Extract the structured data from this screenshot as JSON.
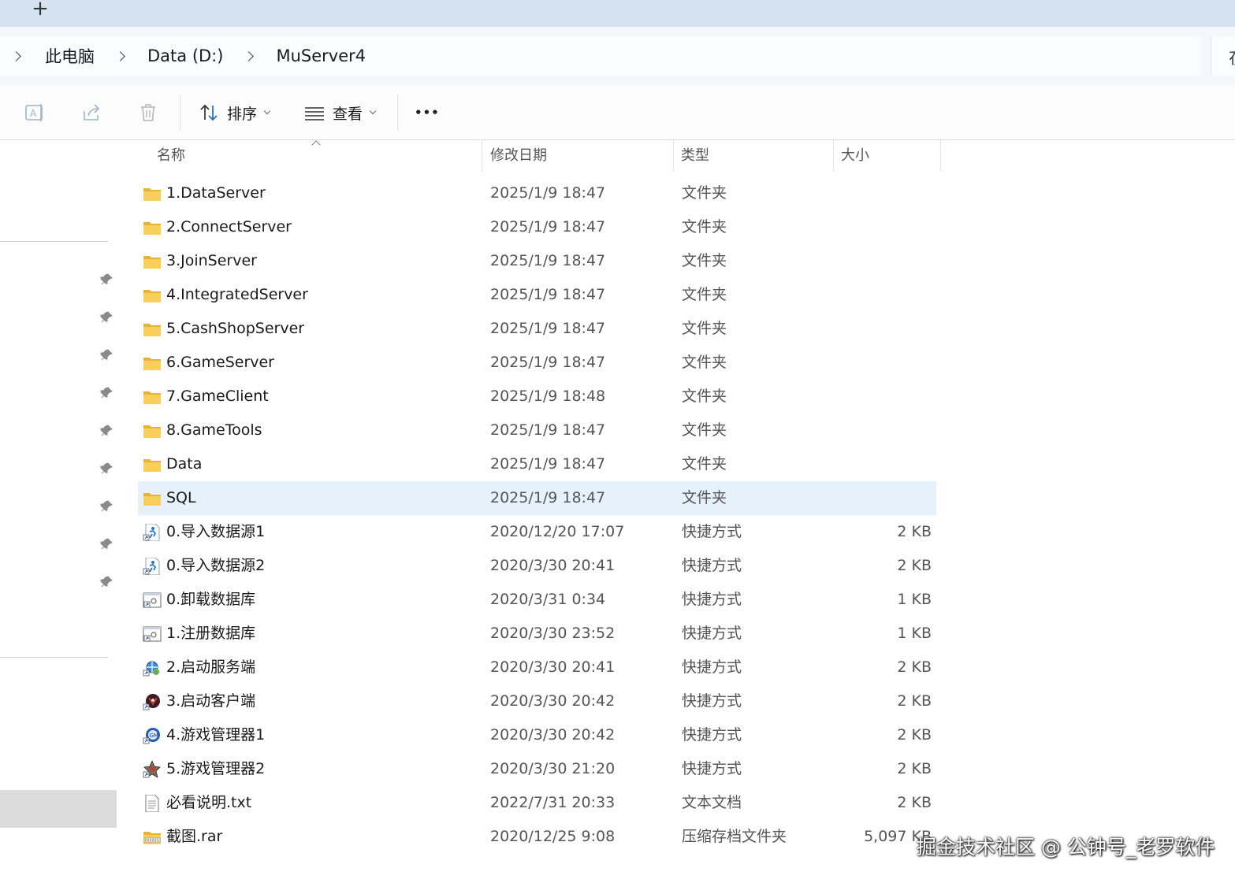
{
  "tabbar": {
    "new_tab_label": "+"
  },
  "breadcrumb": {
    "items": [
      "此电脑",
      "Data (D:)",
      "MuServer4"
    ],
    "search_partial": "在"
  },
  "toolbar": {
    "sort_label": "排序",
    "view_label": "查看",
    "more_label": "•••"
  },
  "columns": {
    "name": "名称",
    "date": "修改日期",
    "type": "类型",
    "size": "大小"
  },
  "files": [
    {
      "name": "1.DataServer",
      "date": "2025/1/9 18:47",
      "type": "文件夹",
      "size": "",
      "icon": "folder-icon"
    },
    {
      "name": "2.ConnectServer",
      "date": "2025/1/9 18:47",
      "type": "文件夹",
      "size": "",
      "icon": "folder-icon"
    },
    {
      "name": "3.JoinServer",
      "date": "2025/1/9 18:47",
      "type": "文件夹",
      "size": "",
      "icon": "folder-icon"
    },
    {
      "name": "4.IntegratedServer",
      "date": "2025/1/9 18:47",
      "type": "文件夹",
      "size": "",
      "icon": "folder-icon"
    },
    {
      "name": "5.CashShopServer",
      "date": "2025/1/9 18:47",
      "type": "文件夹",
      "size": "",
      "icon": "folder-icon"
    },
    {
      "name": "6.GameServer",
      "date": "2025/1/9 18:47",
      "type": "文件夹",
      "size": "",
      "icon": "folder-icon"
    },
    {
      "name": "7.GameClient",
      "date": "2025/1/9 18:48",
      "type": "文件夹",
      "size": "",
      "icon": "folder-icon"
    },
    {
      "name": "8.GameTools",
      "date": "2025/1/9 18:47",
      "type": "文件夹",
      "size": "",
      "icon": "folder-icon"
    },
    {
      "name": "Data",
      "date": "2025/1/9 18:47",
      "type": "文件夹",
      "size": "",
      "icon": "folder-icon"
    },
    {
      "name": "SQL",
      "date": "2025/1/9 18:47",
      "type": "文件夹",
      "size": "",
      "icon": "folder-icon",
      "selected": true
    },
    {
      "name": "0.导入数据源1",
      "date": "2020/12/20 17:07",
      "type": "快捷方式",
      "size": "2 KB",
      "icon": "shortcut-run-icon"
    },
    {
      "name": "0.导入数据源2",
      "date": "2020/3/30 20:41",
      "type": "快捷方式",
      "size": "2 KB",
      "icon": "shortcut-run-icon"
    },
    {
      "name": "0.卸载数据库",
      "date": "2020/3/31 0:34",
      "type": "快捷方式",
      "size": "1 KB",
      "icon": "shortcut-app-icon"
    },
    {
      "name": "1.注册数据库",
      "date": "2020/3/30 23:52",
      "type": "快捷方式",
      "size": "1 KB",
      "icon": "shortcut-app-icon"
    },
    {
      "name": "2.启动服务端",
      "date": "2020/3/30 20:41",
      "type": "快捷方式",
      "size": "2 KB",
      "icon": "server-launcher-icon"
    },
    {
      "name": "3.启动客户端",
      "date": "2020/3/30 20:42",
      "type": "快捷方式",
      "size": "2 KB",
      "icon": "game-client-icon"
    },
    {
      "name": "4.游戏管理器1",
      "date": "2020/3/30 20:42",
      "type": "快捷方式",
      "size": "2 KB",
      "icon": "game-manager-icon"
    },
    {
      "name": "5.游戏管理器2",
      "date": "2020/3/30 21:20",
      "type": "快捷方式",
      "size": "2 KB",
      "icon": "game-manager2-icon"
    },
    {
      "name": "必看说明.txt",
      "date": "2022/7/31 20:33",
      "type": "文本文档",
      "size": "2 KB",
      "icon": "text-file-icon"
    },
    {
      "name": "截图.rar",
      "date": "2020/12/25 9:08",
      "type": "压缩存档文件夹",
      "size": "5,097 KB",
      "icon": "archive-icon"
    }
  ],
  "watermark": "掘金技术社区 @ 公钟号_老罗软件",
  "colors": {
    "selection": "#e5f1fb",
    "folder": "#f4c44e",
    "tabstrip": "#d5e3f1"
  }
}
